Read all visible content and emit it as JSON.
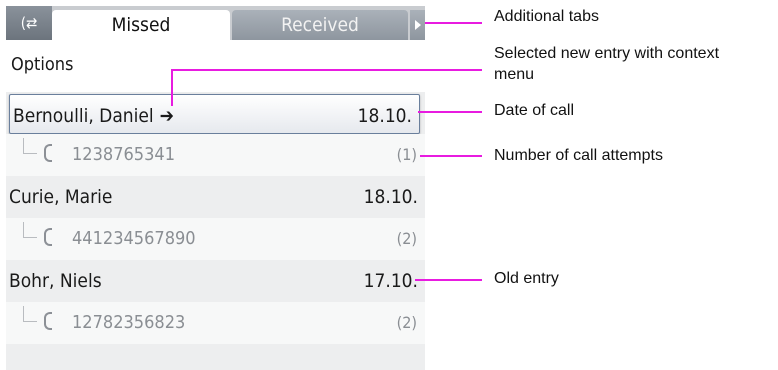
{
  "tabs": {
    "icon": "call-list-icon",
    "missed": "Missed",
    "received": "Received"
  },
  "options": "Options",
  "entries": [
    {
      "name": "Bernoulli, Daniel",
      "date": "18.10.",
      "number": "1238765341",
      "attempts": "(1)"
    },
    {
      "name": "Curie, Marie",
      "date": "18.10.",
      "number": "441234567890",
      "attempts": "(2)"
    },
    {
      "name": "Bohr, Niels",
      "date": "17.10.",
      "number": "12782356823",
      "attempts": "(2)"
    }
  ],
  "annotations": {
    "additional_tabs": "Additional tabs",
    "selected_entry_line1": "Selected new entry with context",
    "selected_entry_line2": "menu",
    "date_of_call": "Date of call",
    "call_attempts": "Number of call attempts",
    "old_entry": "Old entry"
  },
  "colors": {
    "callout": "#e81be0",
    "selection_border": "#6a7f9c"
  }
}
